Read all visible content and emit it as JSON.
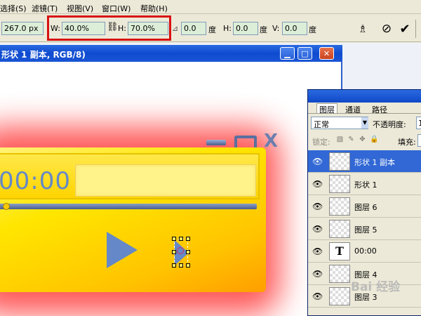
{
  "menu": [
    {
      "label": "选择(S)"
    },
    {
      "label": "滤镜(T)"
    },
    {
      "label": "视图(V)"
    },
    {
      "label": "窗口(W)"
    },
    {
      "label": "帮助(H)"
    }
  ],
  "options": {
    "y_value": "267.0 px",
    "w_label": "W:",
    "w_value": "40.0%",
    "h_label": "H:",
    "h_value": "70.0%",
    "rotate_value": "0.0",
    "rotate_unit": "度",
    "hskew_label": "H:",
    "hskew_value": "0.0",
    "hskew_unit": "度",
    "vskew_label": "V:",
    "vskew_value": "0.0",
    "vskew_unit": "度",
    "highlight_color": "#d81010"
  },
  "document": {
    "title": "形状 1 副本, RGB/8)"
  },
  "artwork": {
    "time": "00:00"
  },
  "layers_panel": {
    "tabs": [
      "图层",
      "通道",
      "路径"
    ],
    "blend_mode": "正常",
    "opacity_label": "不透明度:",
    "opacity_value": "1",
    "lock_label": "锁定:",
    "fill_label": "填充:",
    "layers": [
      {
        "name": "形状 1 副本",
        "selected": true,
        "type": "shape"
      },
      {
        "name": "形状 1",
        "selected": false,
        "type": "shape"
      },
      {
        "name": "图层 6",
        "selected": false,
        "type": "raster"
      },
      {
        "name": "图层 5",
        "selected": false,
        "type": "raster"
      },
      {
        "name": "00:00",
        "selected": false,
        "type": "text",
        "thumb_glyph": "T"
      },
      {
        "name": "图层 4",
        "selected": false,
        "type": "raster"
      },
      {
        "name": "图层 3",
        "selected": false,
        "type": "raster"
      }
    ]
  },
  "watermark": "Bai 经验"
}
